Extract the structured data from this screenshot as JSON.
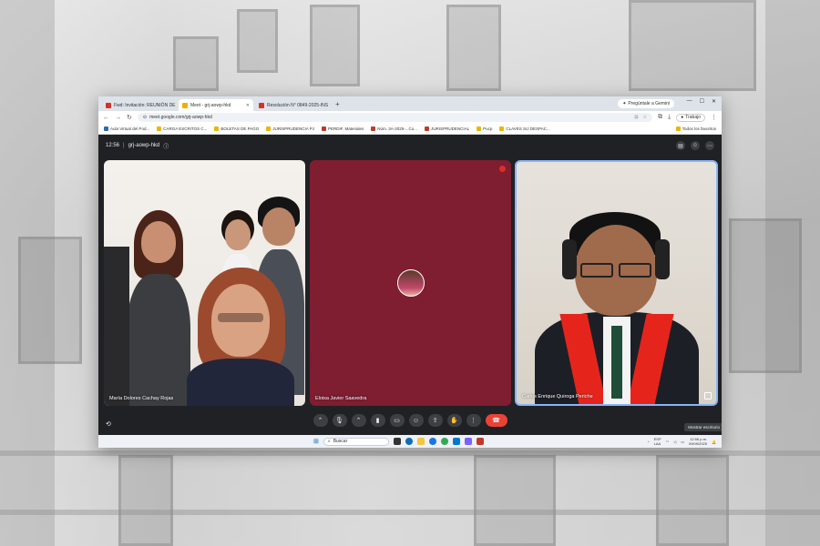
{
  "browser": {
    "tabs": [
      {
        "label": "Fwd: Invitación: REUNIÓN DE",
        "color": "#d93025"
      },
      {
        "label": "Meet - grj-aowp-hkd",
        "color": "#f9ab00",
        "active": true
      },
      {
        "label": "Resolución N° 0849-2025-INS",
        "color": "#d93025"
      }
    ],
    "gemini_label": "Pregúntale a Gemini",
    "url": "meet.google.com/grj-aowp-hkd",
    "profile_label": "Trabajo",
    "bookmarks": [
      "Aula Virtual del Pod...",
      "CARGA ESCRITOS C...",
      "BOLETAS DE PAGO",
      "JURISPRUDENCIA PJ",
      "PERDIF. Materiales",
      "Núm. 3A-2025-...Co...",
      "JURISPRUDENCIAL",
      "Pucp",
      "CLAVES SIJ DESPAC..."
    ],
    "bookmarks_all": "Todos los favoritos"
  },
  "meet": {
    "time": "12:56",
    "meeting_code": "grj-aowp-hkd",
    "participants": [
      {
        "name": "María Dolores Cachay Rojas"
      },
      {
        "name": "Eloisa Javier Saavedra"
      },
      {
        "name": "Carlos Enrique Quiroga Periche"
      }
    ],
    "tooltip": "Mostrar escritorio"
  },
  "taskbar": {
    "search_placeholder": "Buscar",
    "lang": "ESP",
    "lang_sub": "LAA",
    "clock_time": "12:56 p.m.",
    "clock_date": "09/09/2025"
  }
}
